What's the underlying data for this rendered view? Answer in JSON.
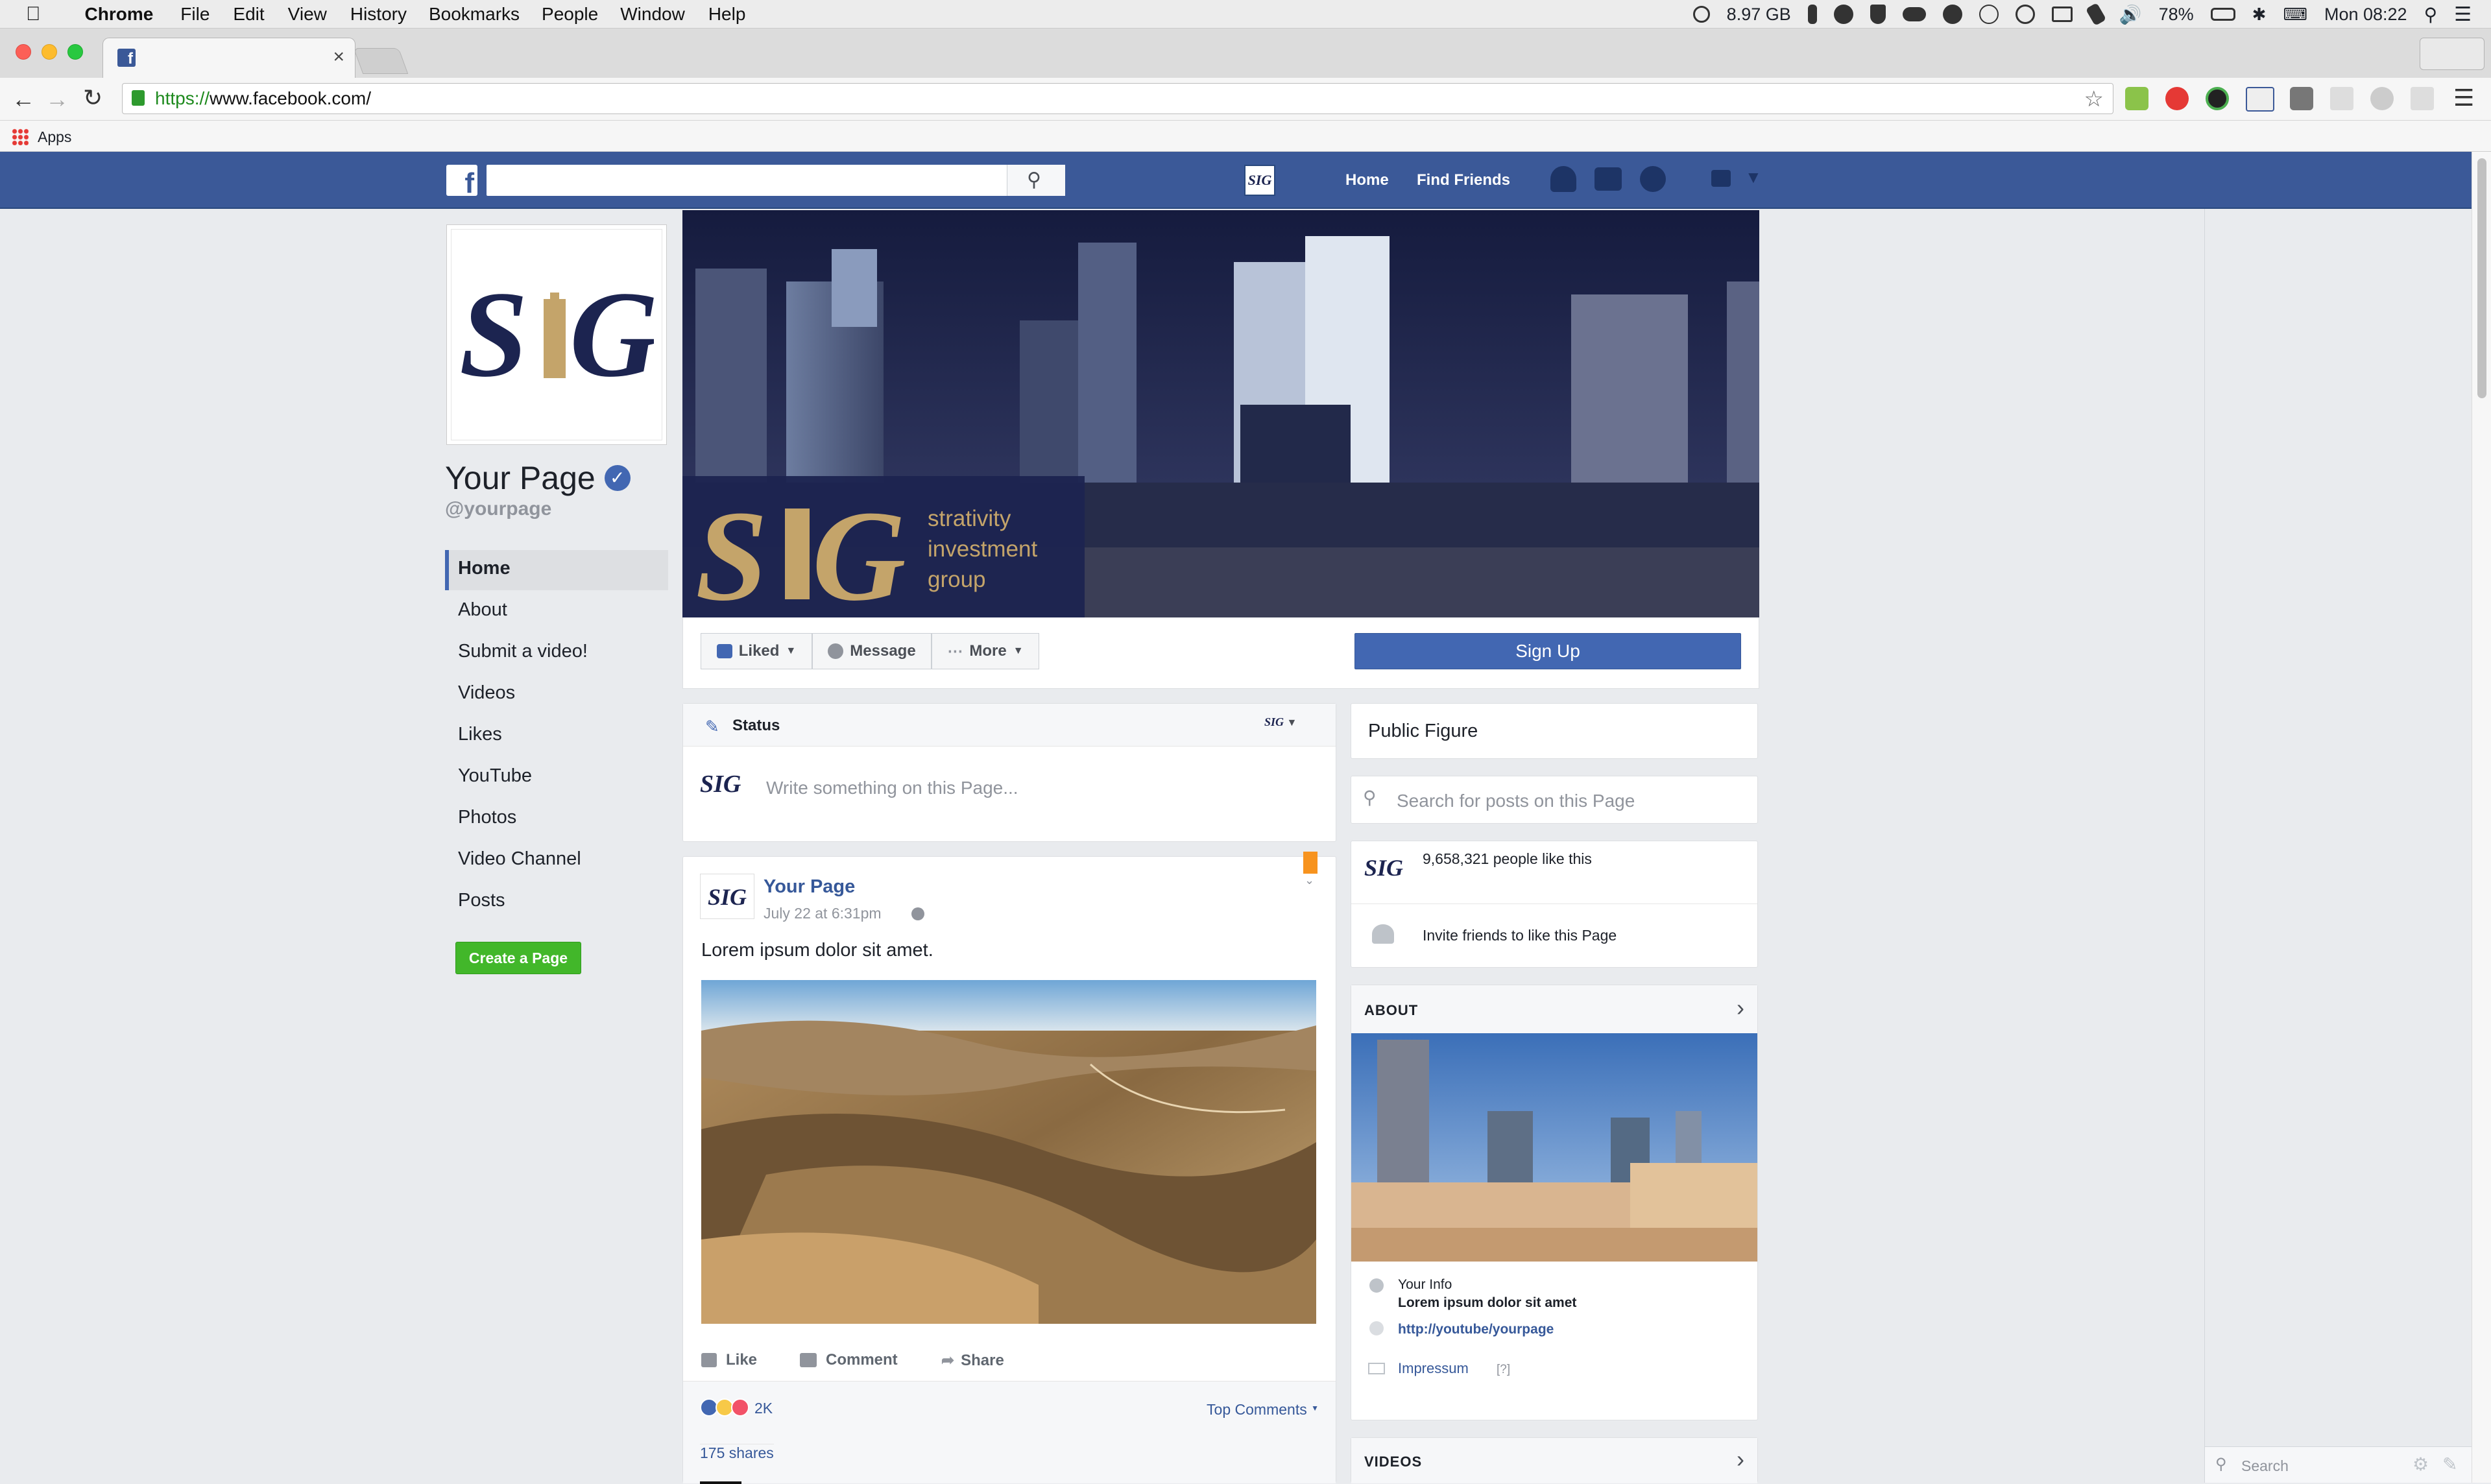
{
  "menubar": {
    "app": "Chrome",
    "items": [
      "File",
      "Edit",
      "View",
      "History",
      "Bookmarks",
      "People",
      "Window",
      "Help"
    ],
    "memory": "8.97 GB",
    "battery": "78%",
    "clock": "Mon 08:22"
  },
  "browser": {
    "tab_close": "×",
    "url_scheme": "https://",
    "url_host": "www.facebook.com/",
    "apps_label": "Apps"
  },
  "fb": {
    "nav_home": "Home",
    "nav_find_friends": "Find Friends",
    "page_name": "Your Page",
    "handle": "@yourpage",
    "left_nav": [
      "Home",
      "About",
      "Submit a video!",
      "Videos",
      "Likes",
      "YouTube",
      "Photos",
      "Video Channel",
      "Posts"
    ],
    "create_page": "Create a Page",
    "cover": {
      "logo": "SIG",
      "tagline_1": "strativity",
      "tagline_2": "investment",
      "tagline_3": "group"
    },
    "actions": {
      "liked": "Liked",
      "message": "Message",
      "more": "More",
      "signup": "Sign Up"
    },
    "composer": {
      "status": "Status",
      "placeholder": "Write something on this Page..."
    },
    "post": {
      "author": "Your Page",
      "time": "July 22 at 6:31pm",
      "text": "Lorem ipsum dolor sit amet.",
      "like": "Like",
      "comment": "Comment",
      "share": "Share",
      "reactions": "2K",
      "top_comments": "Top Comments",
      "shares": "175 shares"
    },
    "right": {
      "category": "Public Figure",
      "search_placeholder": "Search for posts on this Page",
      "likes": "9,658,321 people like this",
      "invite": "Invite friends to like this Page",
      "about_title": "ABOUT",
      "info_label": "Your Info",
      "info_text": "Lorem ipsum dolor sit amet",
      "youtube": "http://youtube/yourpage",
      "impressum": "Impressum",
      "impressum_q": "[?]",
      "videos_title": "VIDEOS"
    },
    "chat_search": "Search"
  },
  "colors": {
    "fb_blue": "#3b5998",
    "signup": "#4267b2",
    "create": "#42b72a",
    "gold": "#c4a46a",
    "navy": "#1c2450"
  }
}
